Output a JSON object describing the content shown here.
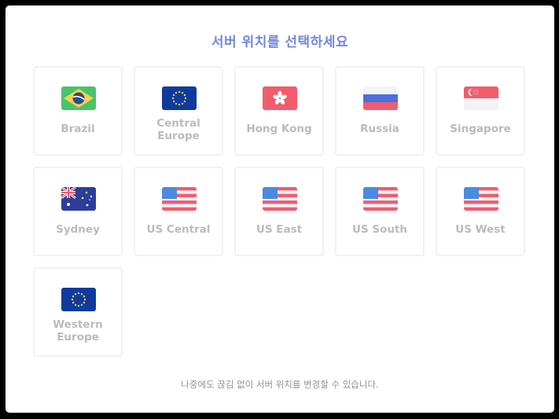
{
  "modal": {
    "title": "서버 위치를 선택하세요",
    "footer": "나중에도 끊김 없이 서버 위치를 변경할 수 있습니다."
  },
  "regions": [
    {
      "label": "Brazil",
      "flag": "brazil-flag-icon"
    },
    {
      "label": "Central\nEurope",
      "flag": "eu-flag-icon"
    },
    {
      "label": "Hong Kong",
      "flag": "hong-kong-flag-icon"
    },
    {
      "label": "Russia",
      "flag": "russia-flag-icon"
    },
    {
      "label": "Singapore",
      "flag": "singapore-flag-icon"
    },
    {
      "label": "Sydney",
      "flag": "australia-flag-icon"
    },
    {
      "label": "US Central",
      "flag": "us-flag-icon"
    },
    {
      "label": "US East",
      "flag": "us-flag-icon"
    },
    {
      "label": "US South",
      "flag": "us-flag-icon"
    },
    {
      "label": "US West",
      "flag": "us-flag-icon"
    },
    {
      "label": "Western\nEurope",
      "flag": "eu-flag-icon"
    }
  ],
  "colors": {
    "title": "#7289da",
    "label": "#b9bbbe",
    "card_border": "#f0f1f3",
    "flag_red": "#f25c6d",
    "flag_blue": "#4a8be0",
    "eu_blue": "#0f3a9e",
    "brazil_green": "#48c36a",
    "brazil_yellow": "#f6d04d"
  }
}
